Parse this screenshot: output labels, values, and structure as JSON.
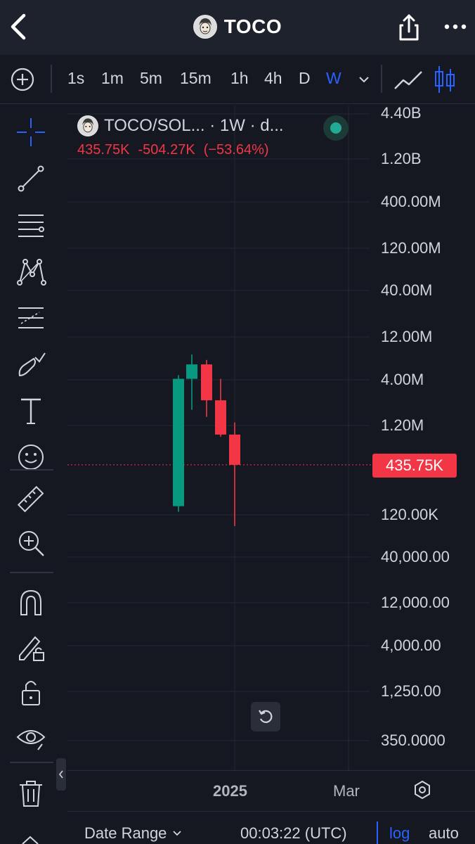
{
  "header": {
    "title": "TOCO",
    "back_icon": "chevron-left-icon",
    "share_icon": "share-icon",
    "more_icon": "more-horizontal-icon"
  },
  "intervals": {
    "items": [
      "1s",
      "1m",
      "5m",
      "15m",
      "1h",
      "4h",
      "D",
      "W"
    ],
    "active": "W"
  },
  "legend": {
    "symbol": "TOCO/SOL... · 1W · d...",
    "last": "435.75K",
    "change": "-504.27K",
    "change_pct": "(−53.64%)",
    "status_color": "#22ab94"
  },
  "price_axis": {
    "labels": [
      "4.40B",
      "1.20B",
      "400.00M",
      "120.00M",
      "40.00M",
      "12.00M",
      "4.00M",
      "1.20M",
      "120.00K",
      "40,000.00",
      "12,000.00",
      "4,000.00",
      "1,250.00",
      "350.0000"
    ],
    "current_price": "435.75K",
    "scale": "log"
  },
  "time_axis": {
    "labels": [
      "2025",
      "Mar"
    ]
  },
  "bottom": {
    "date_range_label": "Date Range",
    "clock": "00:03:22 (UTC)",
    "log_label": "log",
    "auto_label": "auto"
  },
  "colors": {
    "up": "#089981",
    "down": "#f23645",
    "accent": "#2962ff",
    "background": "#151821"
  },
  "chart_data": {
    "type": "candlestick",
    "scale": "log",
    "interval": "1W",
    "ohlc": [
      {
        "open": 150000,
        "high": 4400000,
        "low": 130000,
        "close": 4000000,
        "direction": "up"
      },
      {
        "open": 4000000,
        "high": 7500000,
        "low": 1800000,
        "close": 5800000,
        "direction": "up"
      },
      {
        "open": 5800000,
        "high": 6500000,
        "low": 1500000,
        "close": 2300000,
        "direction": "down"
      },
      {
        "open": 2300000,
        "high": 4000000,
        "low": 900000,
        "close": 950000,
        "direction": "down"
      },
      {
        "open": 950000,
        "high": 1300000,
        "low": 90000,
        "close": 435750,
        "direction": "down"
      }
    ],
    "last_price": 435750,
    "x_labels": [
      "2025",
      "Mar"
    ]
  }
}
